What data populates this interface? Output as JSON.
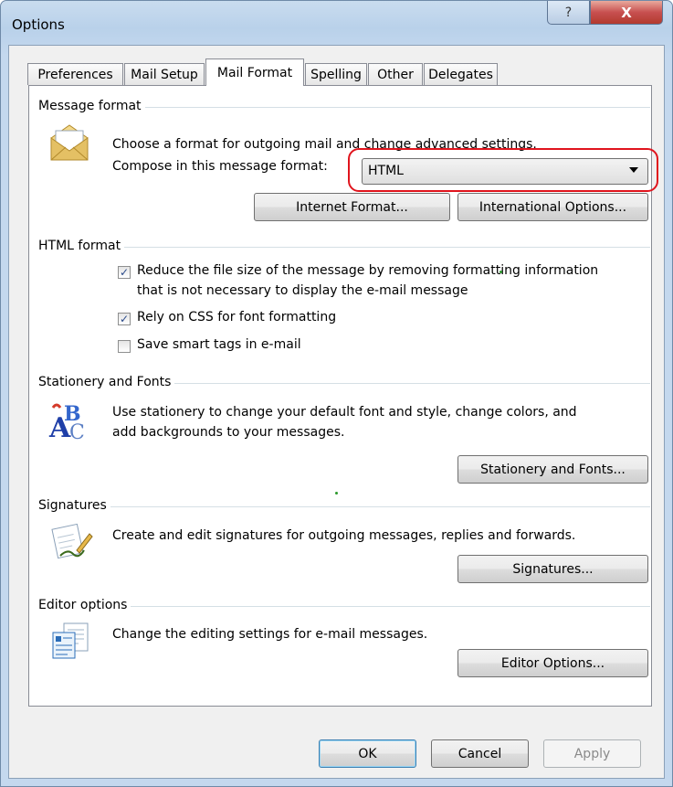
{
  "window": {
    "title": "Options",
    "help_glyph": "?",
    "close_glyph": "X"
  },
  "tabs": [
    "Preferences",
    "Mail Setup",
    "Mail Format",
    "Spelling",
    "Other",
    "Delegates"
  ],
  "active_tab": "Mail Format",
  "message_format": {
    "heading": "Message format",
    "description": "Choose a format for outgoing mail and change advanced settings.",
    "compose_label": "Compose in this message format:",
    "compose_value": "HTML",
    "internet_format_button": "Internet Format...",
    "international_options_button": "International Options..."
  },
  "html_format": {
    "heading": "HTML format",
    "options": [
      {
        "line1": "Reduce the file size of the message by removing formatting information",
        "line2": "that is not necessary to display the e-mail message",
        "checked": true
      },
      {
        "line1": "Rely on CSS for font formatting",
        "line2": "",
        "checked": true
      },
      {
        "line1": "Save smart tags in e-mail",
        "line2": "",
        "checked": false
      }
    ]
  },
  "stationery": {
    "heading": "Stationery and Fonts",
    "line1": "Use stationery to change your default font and style, change colors, and",
    "line2": "add backgrounds to your messages.",
    "button": "Stationery and Fonts..."
  },
  "signatures": {
    "heading": "Signatures",
    "description": "Create and edit signatures for outgoing messages, replies and forwards.",
    "button": "Signatures..."
  },
  "editor": {
    "heading": "Editor options",
    "description": "Change the editing settings for e-mail messages.",
    "button": "Editor Options..."
  },
  "footer": {
    "ok": "OK",
    "cancel": "Cancel",
    "apply": "Apply"
  }
}
